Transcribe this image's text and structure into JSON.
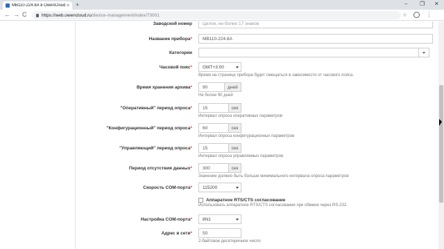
{
  "browser": {
    "tab_title": "МВ110-224.8А в OwenCloud",
    "tab_close": "×",
    "new_tab": "+",
    "url_host": "https://web.owencloud.ru",
    "url_path": "/device-management/index/73001",
    "star": "☆",
    "menu": "⋮",
    "minimize": "–",
    "maximize": "❐",
    "close": "✕",
    "back": "←",
    "forward": "→",
    "reload": "C"
  },
  "form": {
    "required_mark": "*",
    "serial": {
      "label": "Заводской номер",
      "placeholder": "Целое, не более 17 знаков"
    },
    "device_name": {
      "label": "Название прибора",
      "value": "МВ110-224.8А"
    },
    "categories": {
      "label": "Категории",
      "value": ""
    },
    "timezone": {
      "label": "Часовой пояс",
      "value": "GMT+3:00",
      "help": "Время на странице прибора будет смещаться в зависимости от часового пояса."
    },
    "archive": {
      "label": "Время хранения архива",
      "value": "90",
      "unit": "дней",
      "help": "Не более 90 дней"
    },
    "operative": {
      "label": "\"Оперативный\" период опроса",
      "value": "15",
      "unit": "сек",
      "help": "Интервал опроса оперативных параметров"
    },
    "config": {
      "label": "\"Конфигурационный\" период опроса",
      "value": "60",
      "unit": "сек",
      "help": "Интервал опроса конфигурационных параметров"
    },
    "control": {
      "label": "\"Управляющий\" период опроса",
      "value": "15",
      "unit": "сек",
      "help": "Интервал опроса управляемых параметров"
    },
    "absence": {
      "label": "Период отсутствия данных",
      "value": "300",
      "unit": "сек",
      "help": "Значение должно быть больше минимального интервала опроса параметров"
    },
    "baud": {
      "label": "Скорость COM-порта",
      "value": "115200"
    },
    "rtscts": {
      "label": "Аппаратное RTS/CTS согласование",
      "help": "Использовать аппаратное RTS/CTS согласование при обмене через RS-232."
    },
    "com_settings": {
      "label": "Настройка COM-порта",
      "value": "8N1"
    },
    "net_address": {
      "label": "Адрес в сети",
      "value": "50",
      "help": "2-байтовое десятеричное число"
    }
  }
}
